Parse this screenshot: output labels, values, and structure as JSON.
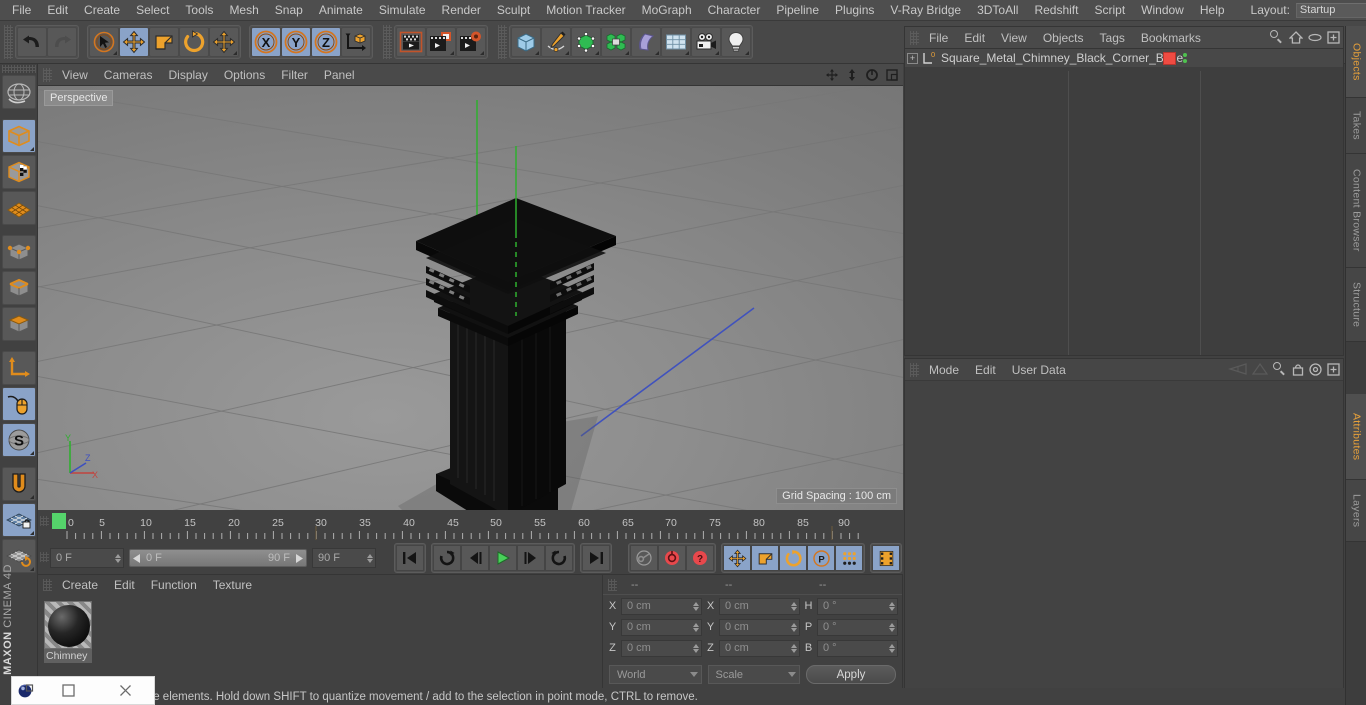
{
  "app": {
    "name": "MAXON CINEMA 4D",
    "brand_top": "MAXON",
    "brand_bottom": "CINEMA 4D"
  },
  "menubar": {
    "items": [
      {
        "label": "File"
      },
      {
        "label": "Edit"
      },
      {
        "label": "Create"
      },
      {
        "label": "Select"
      },
      {
        "label": "Tools"
      },
      {
        "label": "Mesh"
      },
      {
        "label": "Snap"
      },
      {
        "label": "Animate"
      },
      {
        "label": "Simulate"
      },
      {
        "label": "Render"
      },
      {
        "label": "Sculpt"
      },
      {
        "label": "Motion Tracker"
      },
      {
        "label": "MoGraph"
      },
      {
        "label": "Character"
      },
      {
        "label": "Pipeline"
      },
      {
        "label": "Plugins"
      },
      {
        "label": "V-Ray Bridge"
      },
      {
        "label": "3DToAll"
      },
      {
        "label": "Redshift"
      },
      {
        "label": "Script"
      },
      {
        "label": "Window"
      },
      {
        "label": "Help"
      }
    ],
    "layout_label": "Layout:",
    "layout_value": "Startup",
    "search_icon": "search-icon"
  },
  "toolbar": {
    "groups": [
      {
        "name": "undo-redo",
        "buttons": [
          {
            "name": "undo-button",
            "icon": "undo-arrow-icon",
            "active": false
          },
          {
            "name": "redo-button",
            "icon": "redo-arrow-icon",
            "active": false,
            "disabled": true
          }
        ]
      },
      {
        "name": "transform-tools",
        "buttons": [
          {
            "name": "live-selection-tool",
            "icon": "cursor-circle-icon",
            "active": false
          },
          {
            "name": "move-tool",
            "icon": "move-arrows-icon",
            "active": true
          },
          {
            "name": "scale-tool",
            "icon": "scale-box-icon",
            "active": false
          },
          {
            "name": "rotate-tool",
            "icon": "rotate-arc-icon",
            "active": false
          },
          {
            "name": "transform-tool",
            "icon": "move-arrows-icon",
            "active": false
          }
        ]
      },
      {
        "name": "axis-locks",
        "buttons": [
          {
            "name": "x-axis-lock-button",
            "icon": "x-axis-icon",
            "active": true,
            "text": "X"
          },
          {
            "name": "y-axis-lock-button",
            "icon": "y-axis-icon",
            "active": true,
            "text": "Y"
          },
          {
            "name": "z-axis-lock-button",
            "icon": "z-axis-icon",
            "active": true,
            "text": "Z"
          },
          {
            "name": "world-object-coordinates-button",
            "icon": "world-axis-cube-icon",
            "active": false
          }
        ]
      },
      {
        "name": "render-tools",
        "buttons": [
          {
            "name": "render-view-button",
            "icon": "render-clapper-icon",
            "active": false
          },
          {
            "name": "render-to-picture-viewer-button",
            "icon": "render-picture-icon",
            "active": false
          },
          {
            "name": "edit-render-settings-button",
            "icon": "render-settings-gear-icon",
            "active": false
          }
        ]
      },
      {
        "name": "create-objects",
        "buttons": [
          {
            "name": "add-primitive-cube-button",
            "icon": "blue-cube-icon",
            "active": false
          },
          {
            "name": "add-spline-button",
            "icon": "pen-spline-icon",
            "active": false
          },
          {
            "name": "add-generator-button",
            "icon": "green-cube-generator-icon",
            "active": false
          },
          {
            "name": "add-deformer-button",
            "icon": "green-cluster-deformer-icon",
            "active": false
          },
          {
            "name": "add-scene-object-button",
            "icon": "purple-bend-icon",
            "active": false
          },
          {
            "name": "add-environment-button",
            "icon": "grid-floor-icon",
            "active": false
          },
          {
            "name": "add-camera-button",
            "icon": "camera-icon",
            "active": false
          },
          {
            "name": "add-light-button",
            "icon": "lightbulb-icon",
            "active": false
          }
        ]
      }
    ]
  },
  "left_palette": {
    "items": [
      {
        "name": "undo-view-button",
        "icon": "globe-wire-icon",
        "active": false,
        "corner": false
      },
      {
        "name": "model-mode-button",
        "icon": "orange-cube-icon",
        "active": true,
        "corner": true
      },
      {
        "name": "texture-mode-button",
        "icon": "checker-cube-icon",
        "active": false,
        "corner": false
      },
      {
        "name": "polygon-mesh-mode-button",
        "icon": "orange-mesh-plane-icon",
        "active": false,
        "corner": false
      },
      {
        "name": "points-mode-button",
        "icon": "points-cube-icon",
        "active": false,
        "corner": false
      },
      {
        "name": "edges-mode-button",
        "icon": "edges-cube-icon",
        "active": false,
        "corner": false
      },
      {
        "name": "polygons-mode-button",
        "icon": "polygons-cube-icon",
        "active": false,
        "corner": false
      },
      {
        "name": "axis-modification-button",
        "icon": "orange-axis-icon",
        "active": false,
        "corner": false
      },
      {
        "name": "enable-axis-button",
        "icon": "mouse-axis-icon",
        "active": true,
        "corner": false
      },
      {
        "name": "soft-selection-button",
        "icon": "s-sphere-icon",
        "active": true,
        "corner": true
      },
      {
        "name": "snap-magnet-button",
        "icon": "magnet-icon",
        "active": false,
        "corner": true
      },
      {
        "name": "workplane-lock-button",
        "icon": "grid-lock-icon",
        "active": true,
        "corner": true
      },
      {
        "name": "workplane-reset-button",
        "icon": "grid-reset-icon",
        "active": false,
        "corner": true
      }
    ]
  },
  "viewport": {
    "menu": [
      {
        "label": "View"
      },
      {
        "label": "Cameras"
      },
      {
        "label": "Display"
      },
      {
        "label": "Options"
      },
      {
        "label": "Filter"
      },
      {
        "label": "Panel"
      }
    ],
    "right_buttons": [
      {
        "name": "viewport-pan-button",
        "icon": "move-4way-icon"
      },
      {
        "name": "viewport-zoom-button",
        "icon": "updown-arrows-icon"
      },
      {
        "name": "viewport-rotate-button",
        "icon": "rotate-circle-icon"
      },
      {
        "name": "viewport-maximize-button",
        "icon": "maximize-square-icon"
      }
    ],
    "label": "Perspective",
    "grid_spacing": "Grid Spacing : 100 cm",
    "axis_widget": {
      "y": "Y",
      "z": "Z",
      "x": "X"
    }
  },
  "timeline": {
    "ruler_ticks": [
      "0",
      "5",
      "10",
      "15",
      "20",
      "25",
      "30",
      "35",
      "40",
      "45",
      "50",
      "55",
      "60",
      "65",
      "70",
      "75",
      "80",
      "85",
      "90"
    ],
    "ruler_min": 0,
    "ruler_max": 90,
    "playhead_frame": 0,
    "current_frame_field": "0 F",
    "range_start": "0 F",
    "range_end": "90 F",
    "end_frame_field": "90 F",
    "preview_frame_field": "0 F",
    "transport": [
      {
        "name": "go-to-start-button",
        "icon": "skip-start-icon",
        "active": false
      },
      {
        "name": "play-backwards-button",
        "icon": "loop-back-icon",
        "active": false
      },
      {
        "name": "step-back-button",
        "icon": "prev-frame-icon",
        "active": false
      },
      {
        "name": "play-button",
        "icon": "play-triangle-icon",
        "active": false
      },
      {
        "name": "step-forward-button",
        "icon": "next-frame-icon",
        "active": false
      },
      {
        "name": "play-forwards-loop-button",
        "icon": "loop-forward-icon",
        "active": false
      },
      {
        "name": "go-to-end-button",
        "icon": "skip-end-icon",
        "active": false
      }
    ],
    "keyframe_tools": [
      {
        "name": "record-active-objects-button",
        "icon": "key-icon",
        "active": false
      },
      {
        "name": "autokeying-button",
        "icon": "red-circle-record-icon",
        "active": false
      },
      {
        "name": "keyframe-selection-button",
        "icon": "red-question-icon",
        "active": false
      }
    ],
    "key_filters": [
      {
        "name": "position-key-button",
        "icon": "move-arrows-icon",
        "active": true
      },
      {
        "name": "scale-key-button",
        "icon": "scale-box-icon",
        "active": true
      },
      {
        "name": "rotation-key-button",
        "icon": "rotate-arc-icon",
        "active": true
      },
      {
        "name": "parameter-key-button",
        "icon": "p-circle-icon",
        "active": true
      },
      {
        "name": "point-level-animation-button",
        "icon": "dots-grid-icon",
        "active": true
      },
      {
        "name": "timeline-button",
        "icon": "filmstrip-icon",
        "active": true
      }
    ]
  },
  "material_manager": {
    "menu": [
      {
        "label": "Create"
      },
      {
        "label": "Edit"
      },
      {
        "label": "Function"
      },
      {
        "label": "Texture"
      }
    ],
    "materials": [
      {
        "name": "Chimney",
        "preview": "black-glossy-sphere"
      }
    ]
  },
  "coordinates": {
    "header": [
      "--",
      "--",
      "--"
    ],
    "position": {
      "label_x": "X",
      "x": "0 cm",
      "label_y": "Y",
      "y": "0 cm",
      "label_z": "Z",
      "z": "0 cm"
    },
    "size": {
      "label_x": "X",
      "x": "0 cm",
      "label_y": "Y",
      "y": "0 cm",
      "label_z": "Z",
      "z": "0 cm"
    },
    "rotation": {
      "label_h": "H",
      "h": "0 °",
      "label_p": "P",
      "p": "0 °",
      "label_b": "B",
      "b": "0 °"
    },
    "coordinate_system": "World",
    "transform_mode": "Scale",
    "apply_label": "Apply"
  },
  "object_manager": {
    "menu": [
      {
        "label": "File"
      },
      {
        "label": "Edit"
      },
      {
        "label": "View"
      },
      {
        "label": "Objects"
      },
      {
        "label": "Tags"
      },
      {
        "label": "Bookmarks"
      }
    ],
    "right_icons": [
      {
        "name": "search-icon"
      },
      {
        "name": "home-icon"
      },
      {
        "name": "eye-ellipse-icon"
      },
      {
        "name": "new-layer-plus-icon"
      }
    ],
    "objects": [
      {
        "name": "Square_Metal_Chimney_Black_Corner_Base",
        "expander": "+",
        "icon": "null-object-icon",
        "tag_color": "#ef4b42",
        "visibility_dots": 2
      }
    ]
  },
  "attribute_manager": {
    "menu": [
      {
        "label": "Mode"
      },
      {
        "label": "Edit"
      },
      {
        "label": "User Data"
      }
    ],
    "right_icons": [
      {
        "name": "history-back-icon"
      },
      {
        "name": "history-forward-icon"
      },
      {
        "name": "search-icon"
      },
      {
        "name": "lock-icon"
      },
      {
        "name": "target-icon"
      },
      {
        "name": "new-plus-icon"
      }
    ]
  },
  "vertical_tabs": [
    {
      "label": "Objects",
      "selected": true
    },
    {
      "label": "Takes",
      "selected": false
    },
    {
      "label": "Content Browser",
      "selected": false
    },
    {
      "label": "Structure",
      "selected": false
    },
    {
      "label": "Attributes",
      "selected": true
    },
    {
      "label": "Layers",
      "selected": false
    }
  ],
  "status_bar": {
    "text": "Click and drag to move elements. Hold down SHIFT to quantize movement / add to the selection in point mode, CTRL to remove."
  },
  "window_popup": {
    "app_icon": "c4d-sphere-icon",
    "restore_button": "restore-window-icon",
    "maximize_button": "maximize-window-icon",
    "close_button": "close-window-icon"
  },
  "colors": {
    "accent_orange": "#e8a13a",
    "active_blue": "#8aa3c8",
    "tag_red": "#ef4b42",
    "dot_green": "#4fc24f",
    "panel_bg": "#414141"
  }
}
